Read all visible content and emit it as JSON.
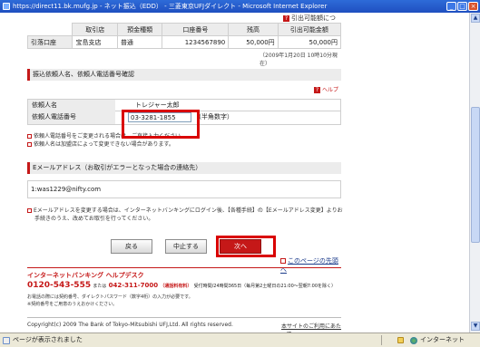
{
  "window": {
    "title": "https://direct11.bk.mufg.jp - ネット振込（EDD） - 三菱東京UFJダイレクト - Microsoft Internet Explorer",
    "buttons": [
      "_",
      "□",
      "×"
    ]
  },
  "top_link": "引出可能額について",
  "account_table": {
    "headers": [
      "取引店",
      "預金種類",
      "口座番号",
      "残高",
      "引出可能金額"
    ],
    "row_label": "引落口座",
    "row": [
      "宝島支店",
      "普通",
      "1234567890",
      "50,000円",
      "50,000円"
    ],
    "timestamp": "（2009年1月20日 10時10分現在）"
  },
  "requester_section": {
    "title": "振込依頼人名、依頼人電話番号確認",
    "help_label": "ヘルプ",
    "name_label": "依頼人名",
    "name_value": "トレジャー太郎",
    "phone_label": "依頼人電話番号",
    "phone_value": "03-3281-1855",
    "phone_hint": "（半角数字）",
    "notes": [
      "依頼人電話番号をご変更される場合は、ご直接入力ください。",
      "依頼人名は加盟店によって変更できない場合があります。"
    ]
  },
  "email_section": {
    "title": "Eメールアドレス（お取引がエラーとなった場合の連絡先）",
    "value": "1:was1229@nifty.com",
    "notes": [
      "Eメールアドレスを変更する場合は、インターネットバンキングにログイン後、【各種手続】の【Eメールアドレス変更】よりお",
      "手続きのうえ、改めてお取引を行ってください。"
    ]
  },
  "buttons": {
    "back": "戻る",
    "cancel": "中止する",
    "next": "次へ"
  },
  "to_top": "このページの先頭へ",
  "helpdesk": {
    "title": "インターネットバンキング ヘルプデスク",
    "phone_free": "0120-543-555",
    "phone_mid": "または",
    "phone_paid": "042-311-7000",
    "phone_paid_note": "（通話料有料）",
    "hours": "受付時間/24時間365日（毎月第2土曜日の21:00～翌朝7:00を除く）",
    "fine": [
      "お電話の際には契約番号、ダイレクトパスワード（数字4桁）の入力が必要です。",
      "※契約番号をご用意のうえおかけください。"
    ]
  },
  "copyright": "Copyright(c) 2009 The Bank of Tokyo-Mitsubishi UFJ,Ltd. All rights reserved.",
  "footer_link": "本サイトのご利用にあたって",
  "statusbar": {
    "text": "ページが表示されました",
    "zone": "インターネット"
  }
}
